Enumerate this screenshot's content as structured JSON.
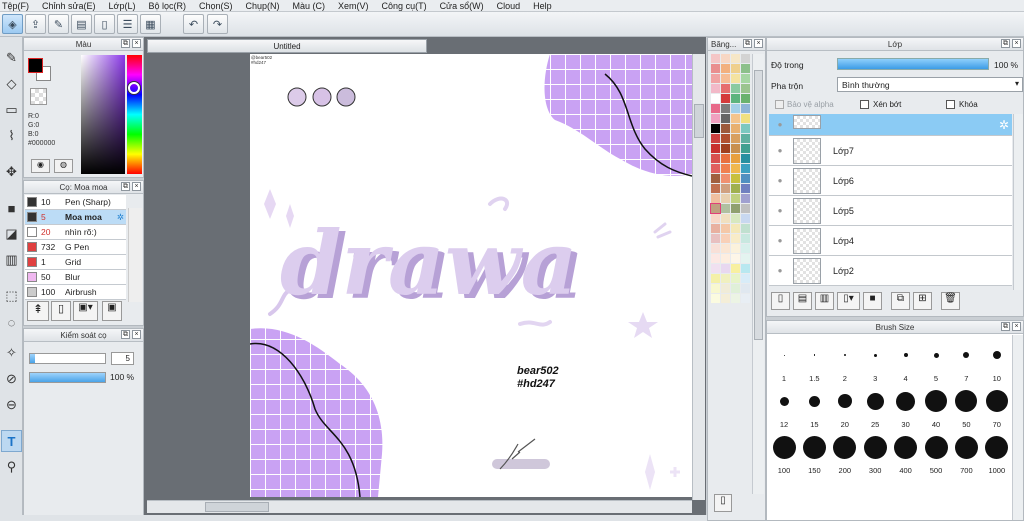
{
  "menu": [
    "Tệp(F)",
    "Chỉnh sửa(E)",
    "Lớp(L)",
    "Bộ lọc(R)",
    "Chọn(S)",
    "Chụp(N)",
    "Màu (C)",
    "Xem(V)",
    "Công cụ(T)",
    "Cửa sổ(W)",
    "Cloud",
    "Help"
  ],
  "color_panel": {
    "title": "Màu",
    "r": "R:0",
    "g": "G:0",
    "b": "B:0",
    "hex": "#000000",
    "primary": "#000000",
    "secondary": "#ffffff"
  },
  "brush_panel": {
    "title": "Cọ: Moa moa",
    "items": [
      {
        "size": "10",
        "name": "Pen (Sharp)",
        "color": "#333333",
        "red": false
      },
      {
        "size": "5",
        "name": "Moa moa",
        "color": "#333333",
        "red": true,
        "selected": true
      },
      {
        "size": "20",
        "name": "nhìn rõ:)",
        "color": "#ffffff",
        "red": true
      },
      {
        "size": "732",
        "name": "G Pen",
        "color": "#e04040",
        "red": false
      },
      {
        "size": "1",
        "name": "Grid",
        "color": "#e04040",
        "red": false
      },
      {
        "size": "50",
        "name": "Blur",
        "color": "#f0b8f0",
        "red": false
      },
      {
        "size": "100",
        "name": "Airbrush",
        "color": "#cccccc",
        "red": false
      }
    ]
  },
  "brush_control": {
    "title": "Kiểm soát cọ",
    "size": "5",
    "opacity": "100 %"
  },
  "document": {
    "title": "Untitled"
  },
  "canvas": {
    "tiny_text_1": "@bear502",
    "tiny_text_2": "#hd247",
    "word": "drawa",
    "sig1": "bear502",
    "sig2": "#hd247"
  },
  "palette_title": "Băng...",
  "layers": {
    "title": "Lớp",
    "opacity_label": "Độ trong",
    "opacity_value": "100 %",
    "blend_label": "Pha trộn",
    "blend_value": "Bình thường",
    "protect_alpha": "Bảo vệ alpha",
    "clip": "Xén bớt",
    "lock": "Khóa",
    "items": [
      {
        "name": "",
        "selected": true
      },
      {
        "name": "Lớp7"
      },
      {
        "name": "Lớp6"
      },
      {
        "name": "Lớp5"
      },
      {
        "name": "Lớp4"
      },
      {
        "name": "Lớp2"
      }
    ]
  },
  "brush_size": {
    "title": "Brush Size",
    "sizes": [
      "1",
      "1.5",
      "2",
      "3",
      "4",
      "5",
      "7",
      "10",
      "12",
      "15",
      "20",
      "25",
      "30",
      "40",
      "50",
      "70",
      "100",
      "150",
      "200",
      "300",
      "400",
      "500",
      "700",
      "1000"
    ]
  }
}
